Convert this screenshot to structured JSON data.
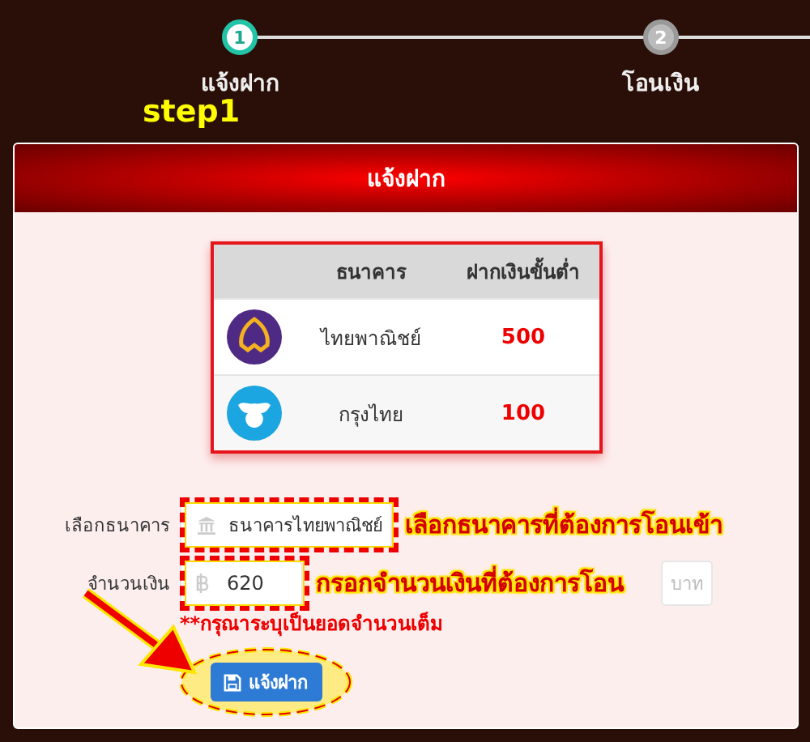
{
  "steps": [
    {
      "number": "1",
      "label": "แจ้งฝาก",
      "selected": true
    },
    {
      "number": "2",
      "label": "โอนเงิน",
      "selected": false
    }
  ],
  "step_note": "step1",
  "card": {
    "title": "แจ้งฝาก"
  },
  "bank_table": {
    "columns": [
      "ธนาคาร",
      "ฝากเงินขั้นต่ำ"
    ],
    "rows": [
      {
        "kind": "leaf",
        "bank": "ไทยพาณิชย์",
        "minimum": "500"
      },
      {
        "kind": "bird",
        "bank": "กรุงไทย",
        "minimum": "100"
      }
    ]
  },
  "form": {
    "bank_label": "เลือกธนาคาร",
    "bank_value": "ธนาคารไทยพาณิชย์",
    "amount_label": "จำนวนเงิน",
    "amount_value": "620",
    "amount_unit": "บาท",
    "warning": "**กรุณาระบุเป็นยอดจำนวนเต็ม",
    "submit": "แจ้งฝาก"
  },
  "annotations": {
    "bank_hint": "เลือกธนาคารที่ต้องการโอนเข้า",
    "amount_hint": "กรอกจำนวนเงินที่ต้องการโอน"
  }
}
